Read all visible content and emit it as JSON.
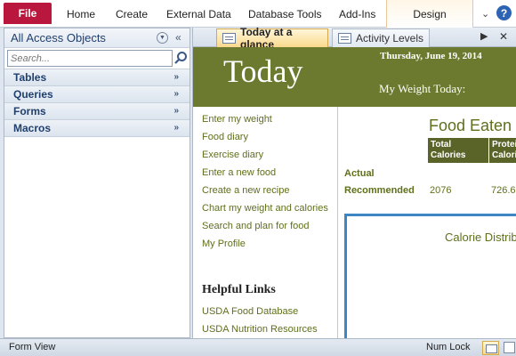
{
  "ribbon": {
    "file": "File",
    "tabs": [
      "Home",
      "Create",
      "External Data",
      "Database Tools",
      "Add-Ins"
    ],
    "context_tab": "Design"
  },
  "nav": {
    "title": "All Access Objects",
    "search_placeholder": "Search...",
    "groups": [
      "Tables",
      "Queries",
      "Forms",
      "Macros"
    ]
  },
  "doc_tabs": {
    "active": "Today at a glance",
    "inactive": "Activity Levels"
  },
  "form": {
    "title": "Today",
    "date": "Thursday, June 19, 2014",
    "weight_label": "My Weight Today:",
    "links": [
      "Enter my weight",
      "Food diary",
      "Exercise diary",
      "Enter a new food",
      "Create a new recipe",
      "Chart my weight and calories",
      "Search and plan for food",
      "My Profile"
    ],
    "helpful_title": "Helpful Links",
    "helpful_links": [
      "USDA Food Database",
      "USDA Nutrition Resources"
    ],
    "food_eaten_title": "Food Eaten",
    "headers": [
      "Total Calories",
      "Protein Calories"
    ],
    "rows": [
      "Actual",
      "Recommended"
    ],
    "recommended_values": [
      "2076",
      "726.6"
    ],
    "chart_title": "Calorie Distribution"
  },
  "status": {
    "left": "Form View",
    "right": "Num Lock"
  },
  "colors": {
    "file_tab": "#b9173d",
    "banner": "#6b7a2f",
    "link_text": "#5f6f1c",
    "header_cell": "#5a6428",
    "chart_border": "#3c86c6"
  }
}
